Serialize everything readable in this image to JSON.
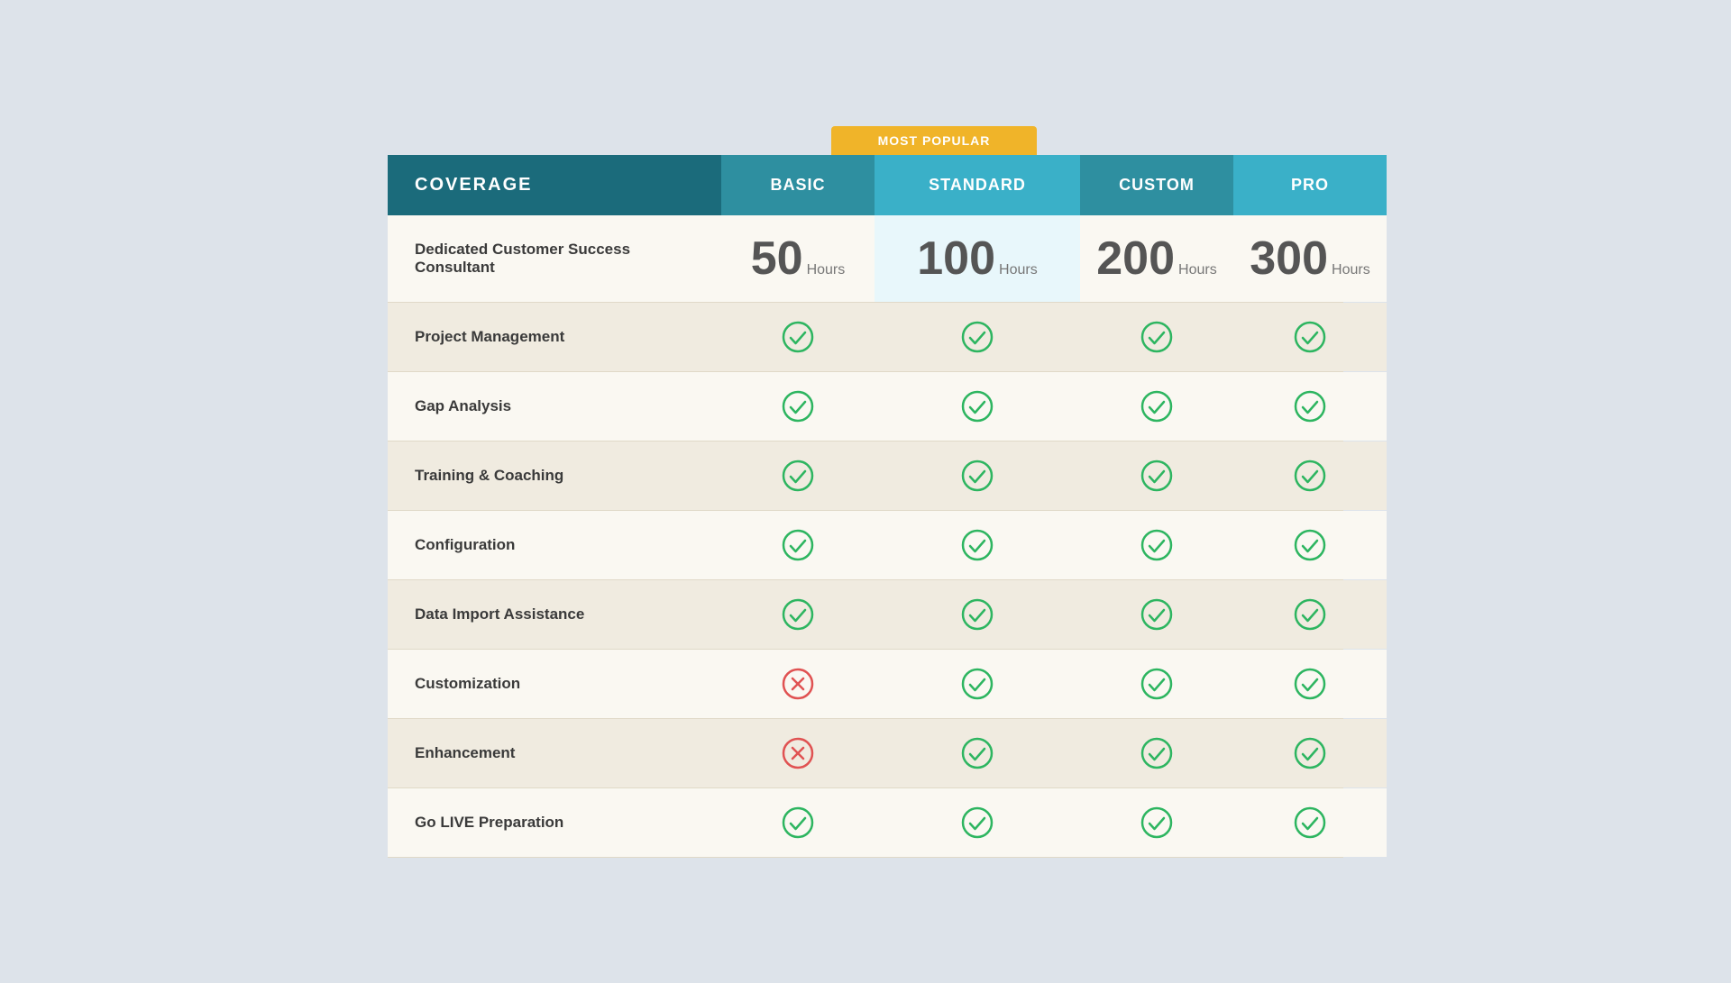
{
  "badge": {
    "label": "MOST POPULAR"
  },
  "headers": {
    "coverage": "COVERAGE",
    "basic": "BASIC",
    "standard": "STANDARD",
    "custom": "CUSTOM",
    "pro": "PRO"
  },
  "rows": [
    {
      "feature": "Dedicated Customer Success Consultant",
      "basic": {
        "type": "hours",
        "number": "50",
        "label": "Hours"
      },
      "standard": {
        "type": "hours",
        "number": "100",
        "label": "Hours"
      },
      "custom": {
        "type": "hours",
        "number": "200",
        "label": "Hours"
      },
      "pro": {
        "type": "hours",
        "number": "300",
        "label": "Hours"
      }
    },
    {
      "feature": "Project Management",
      "basic": {
        "type": "check"
      },
      "standard": {
        "type": "check"
      },
      "custom": {
        "type": "check"
      },
      "pro": {
        "type": "check"
      }
    },
    {
      "feature": "Gap Analysis",
      "basic": {
        "type": "check"
      },
      "standard": {
        "type": "check"
      },
      "custom": {
        "type": "check"
      },
      "pro": {
        "type": "check"
      }
    },
    {
      "feature": "Training & Coaching",
      "basic": {
        "type": "check"
      },
      "standard": {
        "type": "check"
      },
      "custom": {
        "type": "check"
      },
      "pro": {
        "type": "check"
      }
    },
    {
      "feature": "Configuration",
      "basic": {
        "type": "check"
      },
      "standard": {
        "type": "check"
      },
      "custom": {
        "type": "check"
      },
      "pro": {
        "type": "check"
      }
    },
    {
      "feature": "Data Import Assistance",
      "basic": {
        "type": "check"
      },
      "standard": {
        "type": "check"
      },
      "custom": {
        "type": "check"
      },
      "pro": {
        "type": "check"
      }
    },
    {
      "feature": "Customization",
      "basic": {
        "type": "cross"
      },
      "standard": {
        "type": "check"
      },
      "custom": {
        "type": "check"
      },
      "pro": {
        "type": "check"
      }
    },
    {
      "feature": "Enhancement",
      "basic": {
        "type": "cross"
      },
      "standard": {
        "type": "check"
      },
      "custom": {
        "type": "check"
      },
      "pro": {
        "type": "check"
      }
    },
    {
      "feature": "Go LIVE Preparation",
      "basic": {
        "type": "check"
      },
      "standard": {
        "type": "check"
      },
      "custom": {
        "type": "check"
      },
      "pro": {
        "type": "check"
      }
    }
  ]
}
